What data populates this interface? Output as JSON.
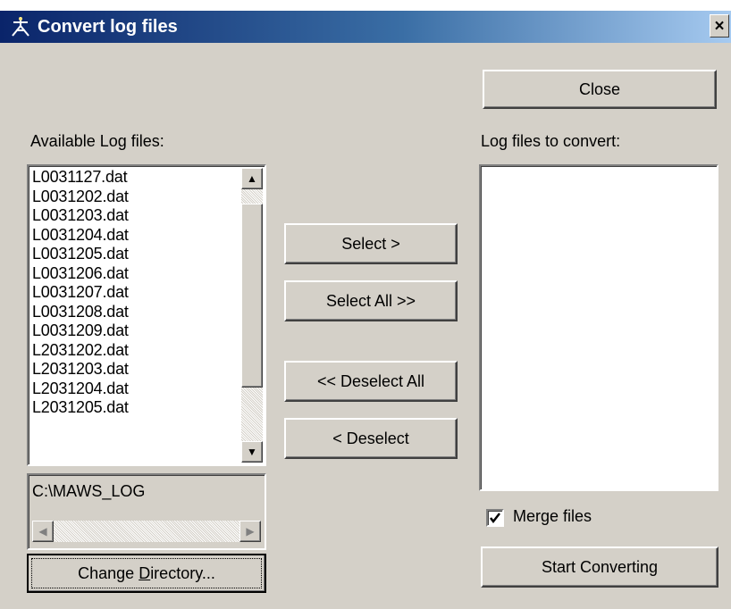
{
  "window": {
    "title": "Convert log files",
    "close_glyph": "×",
    "title_icon": "app-icon"
  },
  "buttons": {
    "close": "Close",
    "select": "Select >",
    "select_all": "Select All >>",
    "deselect_all": "<< Deselect All",
    "deselect": "< Deselect",
    "change_directory_pre": "Change ",
    "change_directory_accel": "D",
    "change_directory_post": "irectory...",
    "start_converting": "Start Converting"
  },
  "available": {
    "label": "Available Log files:",
    "items": [
      "L0031127.dat",
      "L0031202.dat",
      "L0031203.dat",
      "L0031204.dat",
      "L0031205.dat",
      "L0031206.dat",
      "L0031207.dat",
      "L0031208.dat",
      "L0031209.dat",
      "L2031202.dat",
      "L2031203.dat",
      "L2031204.dat",
      "L2031205.dat"
    ]
  },
  "directory": {
    "path": "C:\\MAWS_LOG"
  },
  "convert": {
    "label": "Log files to convert:",
    "items": []
  },
  "merge": {
    "label": "Merge files",
    "checked": true
  },
  "colors": {
    "title_gradient_start": "#0a246a",
    "title_gradient_end": "#a6caf0",
    "face": "#d4d0c8"
  }
}
